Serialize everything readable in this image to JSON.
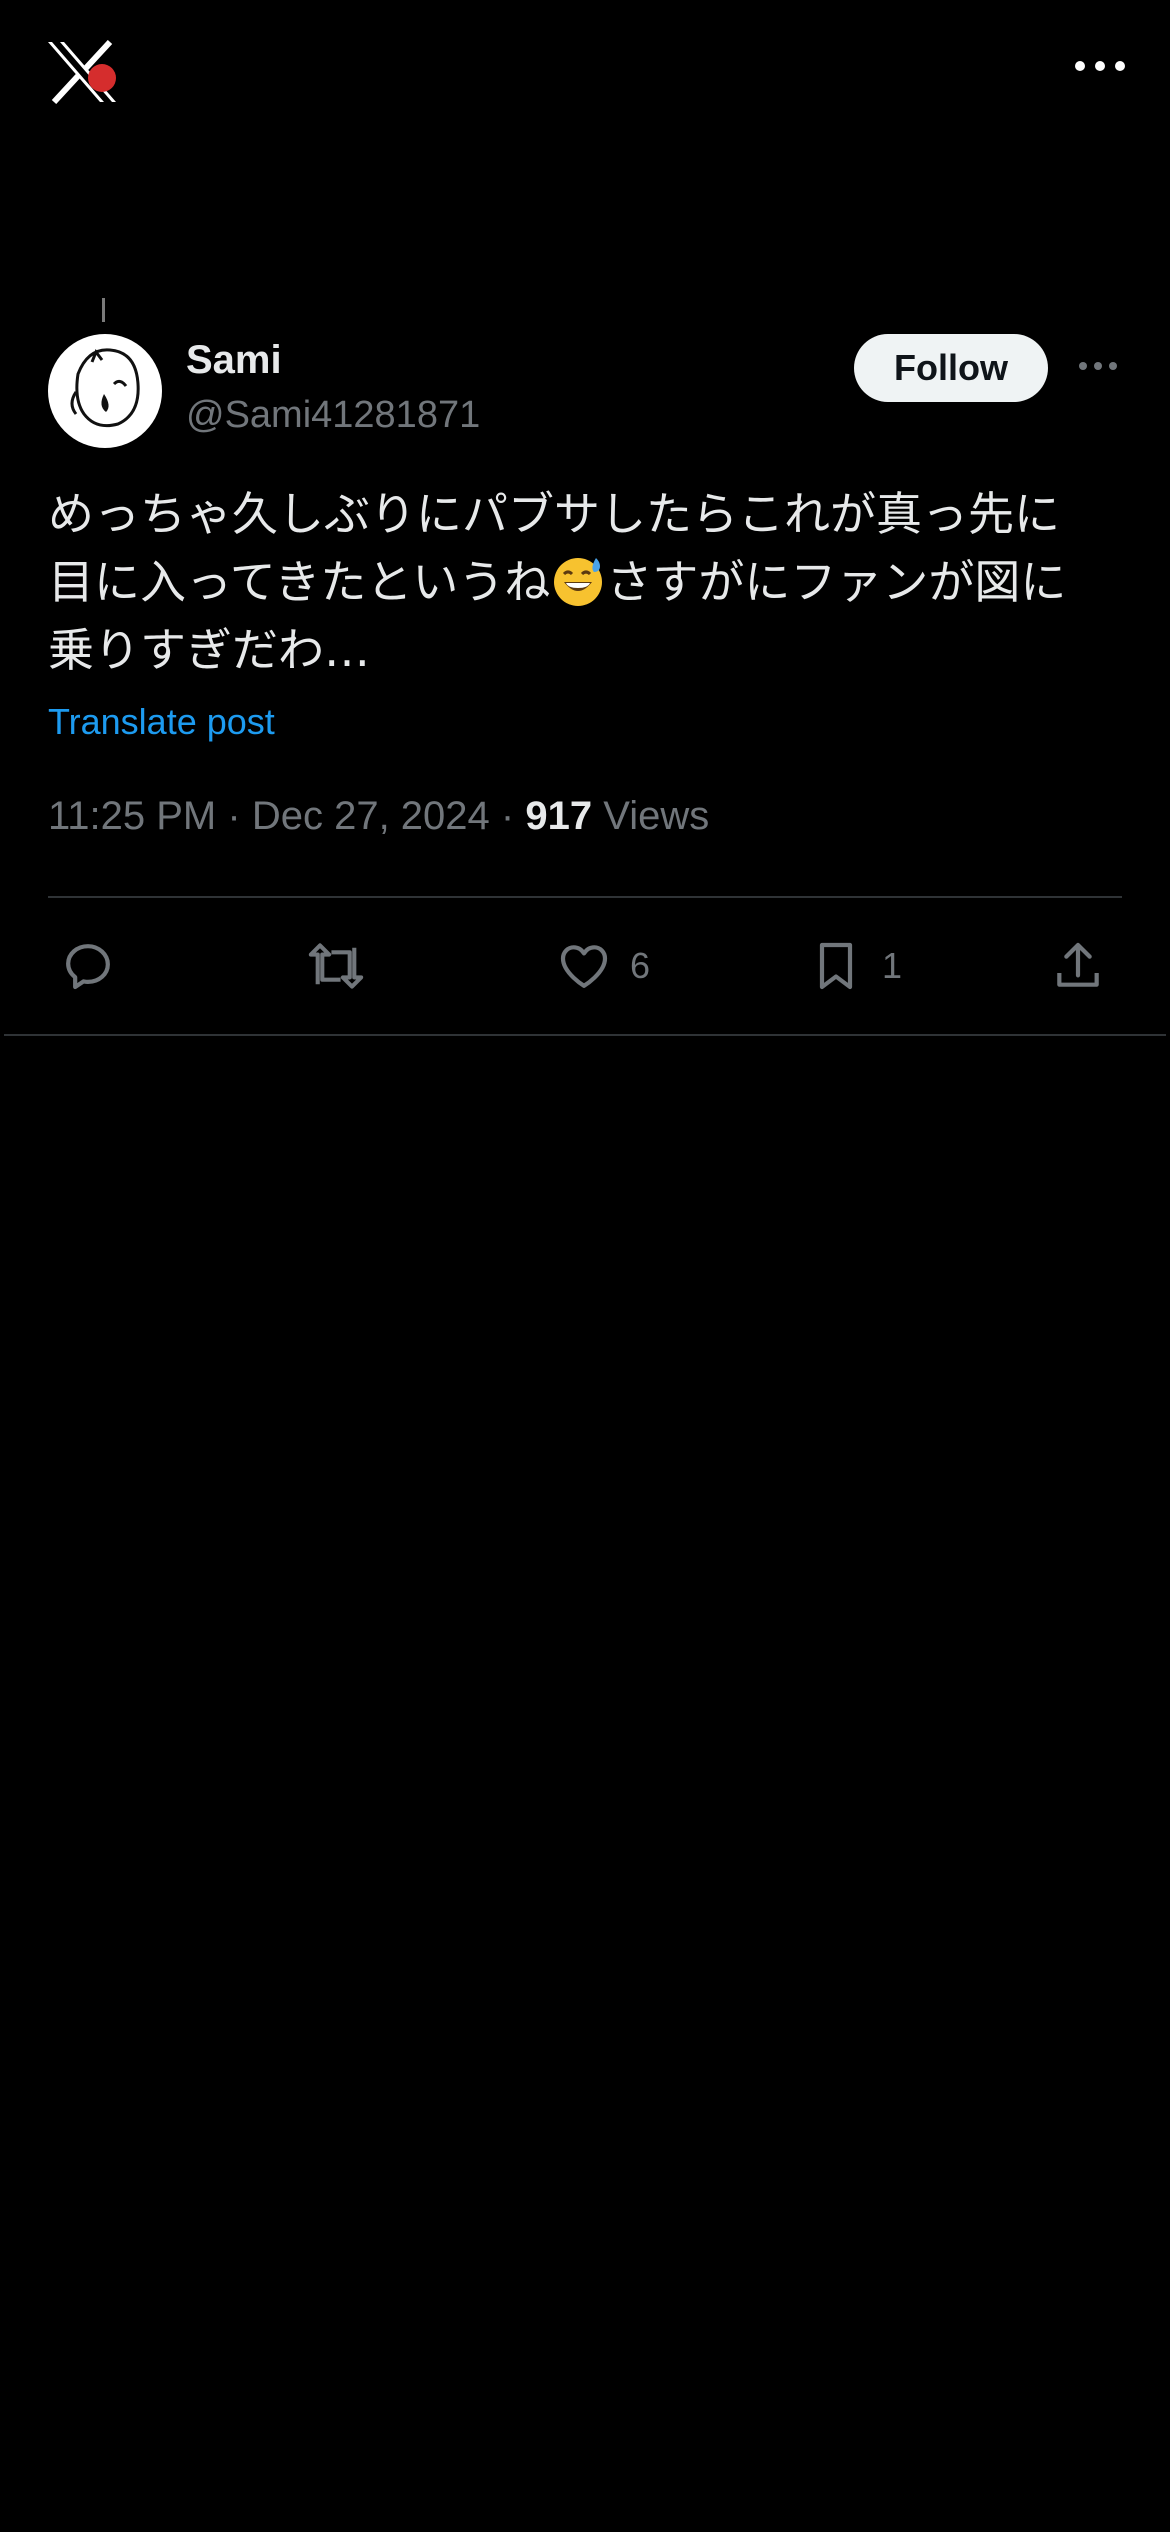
{
  "app": {
    "logo_icon": "x-logo-icon",
    "more_icon": "more-horizontal-icon"
  },
  "post": {
    "author": {
      "display_name": "Sami",
      "handle": "@Sami41281871",
      "avatar_icon": "avatar-drawing"
    },
    "follow_label": "Follow",
    "more_icon": "more-horizontal-icon",
    "text_lines": [
      "めっちゃ久しぶりにパブサしたらこれが真っ先に",
      "目に入ってきたというね",
      "さすがにファンが図に",
      "乗りすぎだわ…"
    ],
    "emoji": "grinning-face-with-sweat",
    "translate_label": "Translate post",
    "time": "11:25 PM",
    "date": "Dec 27, 2024",
    "separator": "·",
    "views_count": "917",
    "views_label": "Views"
  },
  "actions": {
    "reply": {
      "icon": "reply-icon",
      "count": ""
    },
    "repost": {
      "icon": "repost-icon",
      "count": ""
    },
    "like": {
      "icon": "heart-icon",
      "count": "6"
    },
    "bookmark": {
      "icon": "bookmark-icon",
      "count": "1"
    },
    "share": {
      "icon": "share-icon"
    }
  },
  "colors": {
    "background": "#000000",
    "text": "#e7e9ea",
    "secondary": "#71767b",
    "link": "#1d9bf0",
    "divider": "#2f3336",
    "follow_bg": "#eff3f4"
  }
}
